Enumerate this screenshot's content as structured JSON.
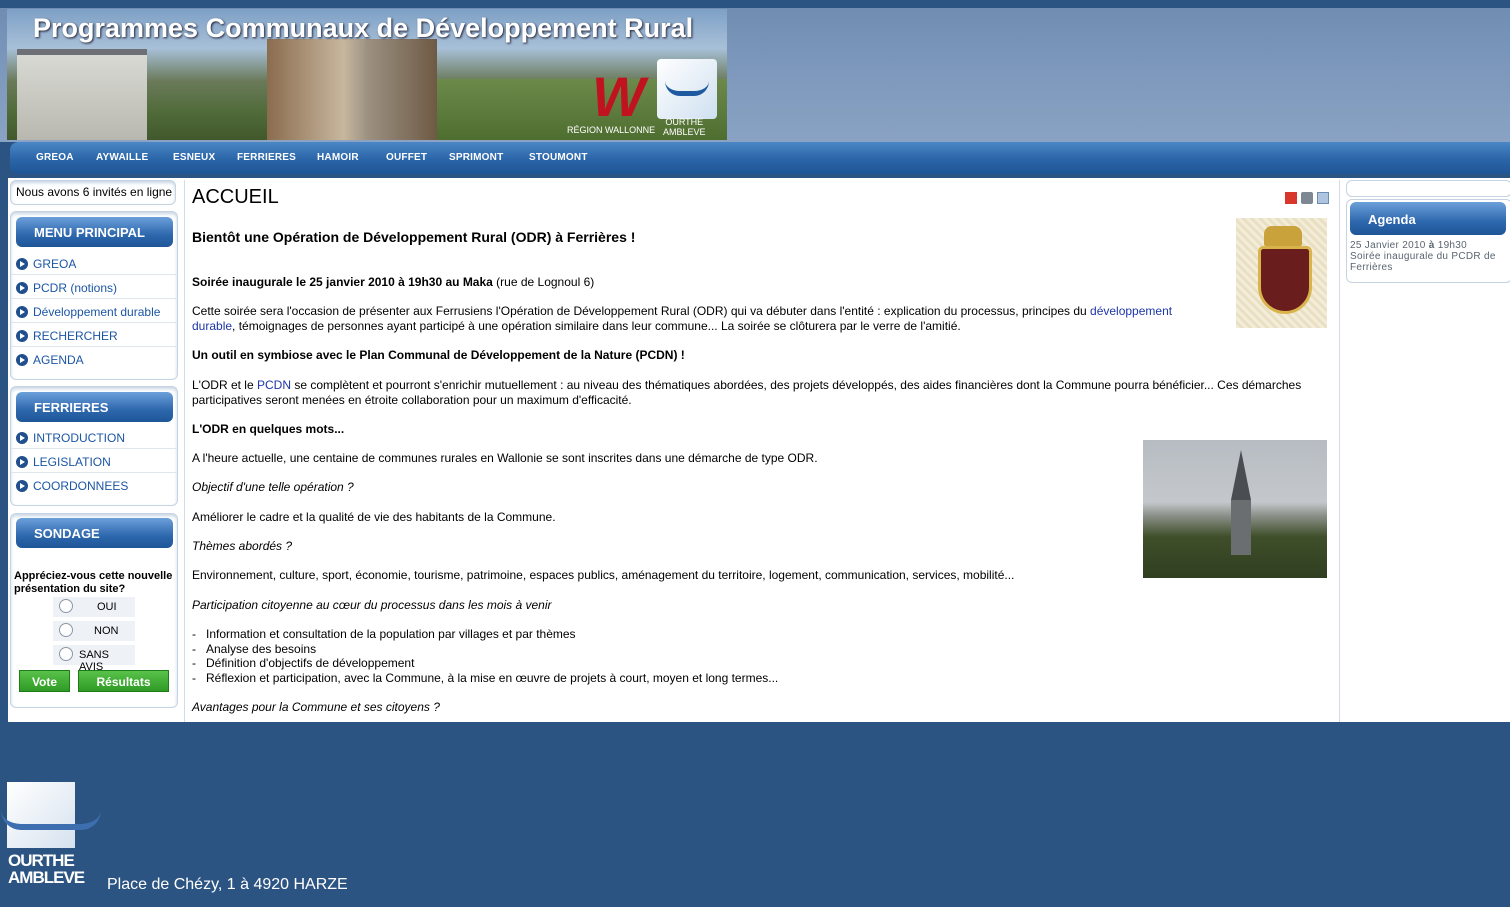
{
  "header": {
    "banner_title": "Programmes Communaux de Développement Rural",
    "wallonie_label": "RÉGION WALLONNE",
    "partner_label_1": "OURTHE",
    "partner_label_2": "AMBLEVE"
  },
  "nav": {
    "items": [
      "GREOA",
      "AYWAILLE",
      "ESNEUX",
      "FERRIERES",
      "HAMOIR",
      "OUFFET",
      "SPRIMONT",
      "STOUMONT"
    ]
  },
  "sidebar": {
    "online_text": "Nous avons 6 invités en ligne",
    "menu_principal": {
      "title": "MENU PRINCIPAL",
      "items": [
        "GREOA",
        "PCDR (notions)",
        "Développement durable",
        "RECHERCHER",
        "AGENDA"
      ]
    },
    "ferrieres": {
      "title": "FERRIERES",
      "items": [
        "INTRODUCTION",
        "LEGISLATION",
        "COORDONNEES"
      ]
    },
    "sondage": {
      "title": "SONDAGE",
      "question": "Appréciez-vous cette nouvelle présentation du site?",
      "options": [
        "OUI",
        "NON",
        "SANS AVIS"
      ],
      "vote_label": "Vote",
      "results_label": "Résultats"
    }
  },
  "main": {
    "page_title": "ACCUEIL",
    "heading": "Bientôt une Opération de Développement Rural (ODR) à Ferrières !",
    "soiree_bold": "Soirée inaugurale le 25 janvier 2010 à 19h30 au Maka",
    "soiree_rest": " (rue de Lognoul 6)",
    "p1_a": "Cette soirée sera l'occasion de présenter aux Ferrusiens l'Opération de Développement Rural (ODR) qui va débuter dans l'entité : explication du processus, principes du ",
    "p1_link": "développement durable",
    "p1_b": ", témoignages de personnes ayant participé à une opération similaire dans leur commune... La soirée se clôturera par le verre de l'amitié.",
    "h_pcdn": "Un outil en symbiose avec le Plan Communal de Développement de la Nature (PCDN) !",
    "p2_a": "L'ODR et le ",
    "p2_link": "PCDN",
    "p2_b": " se complètent et pourront s'enrichir mutuellement : au niveau des thématiques abordées, des projets développés,  des aides  financières  dont la Commune pourra bénéficier... Ces démarches participatives seront menées en étroite collaboration pour un maximum d'efficacité.",
    "h_odr": "L'ODR en quelques mots...",
    "p3": "A l'heure actuelle, une centaine de communes rurales en Wallonie se sont inscrites dans une démarche de type ODR.",
    "q_objectif": "Objectif d'une telle opération ?",
    "a_objectif": "Améliorer le cadre et  la qualité de vie des habitants de la Commune.",
    "q_themes": "Thèmes abordés ?",
    "a_themes": "Environnement, culture, sport, économie, tourisme, patrimoine, espaces publics, aménagement du territoire, logement, communication, services, mobilité...",
    "q_participation": "Participation citoyenne au cœur du processus dans les mois à venir",
    "list": [
      "Information et consultation de la population par villages et par thèmes",
      "Analyse des besoins",
      "Définition d'objectifs de développement",
      "Réflexion et participation, avec la Commune, à la mise en œuvre de projets à court, moyen et long termes..."
    ],
    "q_avantages": "Avantages pour la Commune et ses citoyens ?",
    "icons": [
      "pdf-icon",
      "print-icon",
      "email-icon"
    ]
  },
  "agenda": {
    "title": "Agenda",
    "date_text": "25 Janvier 2010 ",
    "a_bold": "à",
    "time_text": " 19h30",
    "event_text": "Soirée inaugurale du PCDR de Ferrières"
  },
  "footer": {
    "logo_text_1": "OURTHE",
    "logo_text_2": "AMBLEVE",
    "address": "Place de Chézy, 1 à 4920 HARZE"
  },
  "colors": {
    "page_bg": "#2c5482",
    "nav_bg": "#2a65a8",
    "link": "#1d36a8",
    "button_green": "#3aa82f"
  }
}
